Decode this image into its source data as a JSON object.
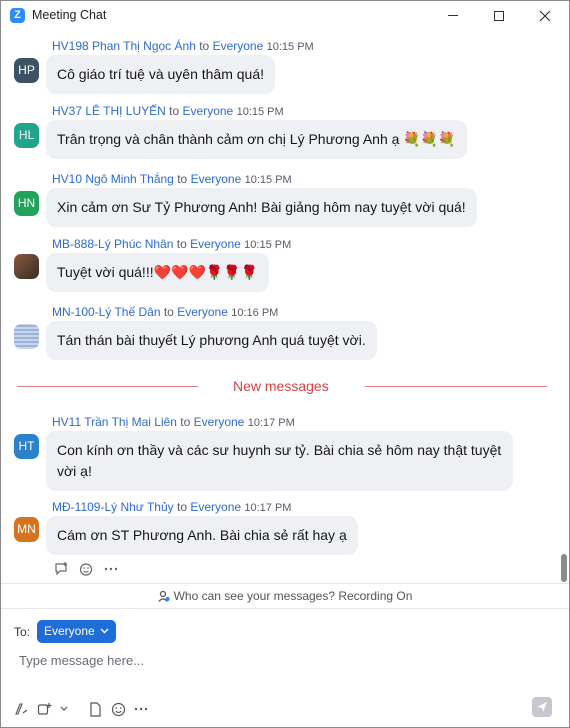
{
  "window": {
    "title": "Meeting Chat",
    "logo_letter": "Z"
  },
  "messages": [
    {
      "sender": "HV198 Phan Thị Ngọc Ánh",
      "to": "to",
      "recipient": "Everyone",
      "time": "10:15 PM",
      "initials": "HP",
      "avatar_color": "#3d5266",
      "text": "Cô giáo trí tuệ và uyên thâm quá!"
    },
    {
      "sender": "HV37 LÊ THỊ LUYẾN",
      "to": "to",
      "recipient": "Everyone",
      "time": "10:15 PM",
      "initials": "HL",
      "avatar_color": "#1fa58c",
      "text": "Trân trọng và chân thành cảm ơn chị Lý Phương Anh ạ 💐💐💐"
    },
    {
      "sender": "HV10 Ngô Minh Thắng",
      "to": "to",
      "recipient": "Everyone",
      "time": "10:15 PM",
      "initials": "HN",
      "avatar_color": "#22a35b",
      "text": "Xin cảm ơn Sư Tỷ Phương Anh! Bài giảng hôm nay tuyệt vời quá!"
    },
    {
      "sender": "MB-888-Lý Phúc Nhân",
      "to": "to",
      "recipient": "Everyone",
      "time": "10:15 PM",
      "initials": "",
      "avatar_color": "#6b4a3a",
      "text": "Tuyệt vời quá!!!❤️❤️❤️🌹🌹🌹"
    },
    {
      "sender": "MN-100-Lý Thế Dân",
      "to": "to",
      "recipient": "Everyone",
      "time": "10:16 PM",
      "initials": "",
      "avatar_color": "#a9c0e0",
      "text": "Tán thán bài thuyết Lý phương Anh quá tuyệt vời."
    },
    {
      "sender": "HV11 Trần Thị Mai Liên",
      "to": "to",
      "recipient": "Everyone",
      "time": "10:17 PM",
      "initials": "HT",
      "avatar_color": "#2b82c9",
      "text": "Con kính ơn thầy và các sư huynh sư tỷ. Bài chia sẻ hôm nay thật tuyệt vời ạ!"
    },
    {
      "sender": "MĐ-1109-Lý Như Thủy",
      "to": "to",
      "recipient": "Everyone",
      "time": "10:17 PM",
      "initials": "MN",
      "avatar_color": "#d4741f",
      "text": "Cám ơn ST Phương Anh. Bài chia sẻ rất hay ạ"
    }
  ],
  "divider_label": "New messages",
  "privacy_text": "Who can see your messages? Recording On",
  "compose": {
    "to_label": "To:",
    "recipient": "Everyone",
    "placeholder": "Type message here..."
  }
}
